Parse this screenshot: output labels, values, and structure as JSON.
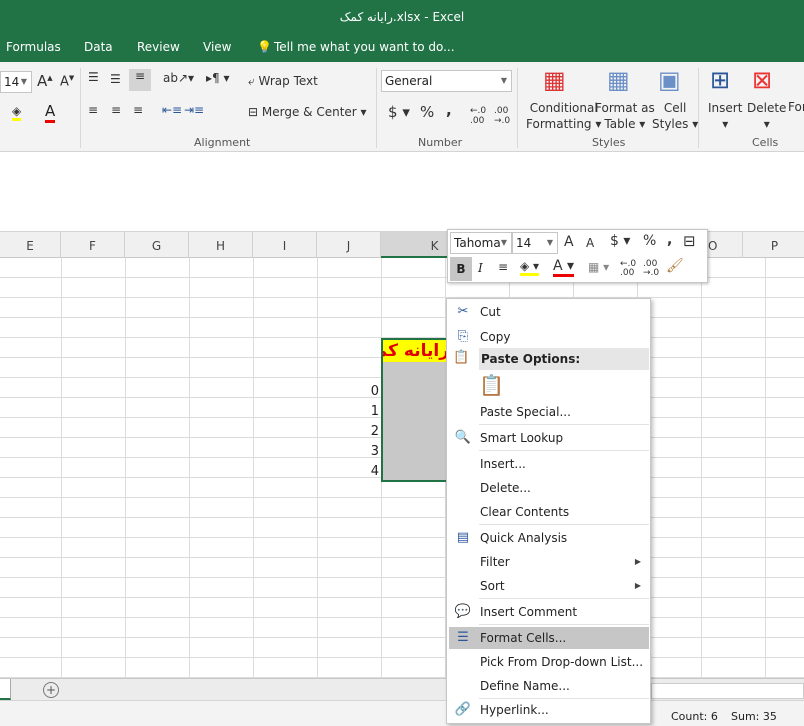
{
  "window": {
    "title": "رایانه کمک.xlsx - Excel"
  },
  "tabs": [
    "Formulas",
    "Data",
    "Review",
    "View"
  ],
  "tell_me": "Tell me what you want to do...",
  "ribbon": {
    "font_size": "14",
    "wrap_text": "Wrap Text",
    "merge_center": "Merge & Center",
    "number_format": "General",
    "currency": "$",
    "percent": "%",
    "comma": ",",
    "conditional_formatting": [
      "Conditional",
      "Formatting"
    ],
    "format_as_table": [
      "Format as",
      "Table"
    ],
    "cell_styles": [
      "Cell",
      "Styles"
    ],
    "insert": "Insert",
    "delete": "Delete",
    "format": "For",
    "groups": {
      "alignment": "Alignment",
      "number": "Number",
      "styles": "Styles",
      "cells": "Cells"
    }
  },
  "columns": [
    "E",
    "F",
    "G",
    "H",
    "I",
    "J",
    "K",
    "O",
    "P"
  ],
  "cells": {
    "header": "رایانه کمک",
    "numbers": [
      "0",
      "1",
      "2",
      "3",
      "4"
    ]
  },
  "mini_toolbar": {
    "font": "Tahoma",
    "size": "14",
    "bold": "B",
    "italic": "I"
  },
  "context_menu": {
    "items": [
      {
        "label": "Cut",
        "icon": "scissors-icon",
        "glyph": "✂"
      },
      {
        "label": "Copy",
        "icon": "copy-icon",
        "glyph": "⎘"
      },
      {
        "label": "Paste Options:",
        "icon": "paste-icon",
        "glyph": "📋",
        "header": true
      },
      {
        "label": "Paste Special...",
        "icon": "",
        "glyph": ""
      },
      {
        "label": "Smart Lookup",
        "icon": "smart-lookup-icon",
        "glyph": "🔍"
      },
      {
        "label": "Insert...",
        "icon": "",
        "glyph": ""
      },
      {
        "label": "Delete...",
        "icon": "",
        "glyph": ""
      },
      {
        "label": "Clear Contents",
        "icon": "",
        "glyph": ""
      },
      {
        "label": "Quick Analysis",
        "icon": "quick-analysis-icon",
        "glyph": "▤"
      },
      {
        "label": "Filter",
        "icon": "",
        "glyph": "",
        "submenu": true
      },
      {
        "label": "Sort",
        "icon": "",
        "glyph": "",
        "submenu": true
      },
      {
        "label": "Insert Comment",
        "icon": "comment-icon",
        "glyph": "💬"
      },
      {
        "label": "Format Cells...",
        "icon": "format-cells-icon",
        "glyph": "☰",
        "highlighted": true
      },
      {
        "label": "Pick From Drop-down List...",
        "icon": "",
        "glyph": ""
      },
      {
        "label": "Define Name...",
        "icon": "",
        "glyph": ""
      },
      {
        "label": "Hyperlink...",
        "icon": "hyperlink-icon",
        "glyph": "🔗"
      }
    ]
  },
  "status": {
    "count": "Count: 6",
    "sum": "Sum: 35"
  },
  "colors": {
    "excel_green": "#217346",
    "header_fill": "#ffff00",
    "header_text": "#e00000",
    "selection": "#c8c8c8"
  }
}
